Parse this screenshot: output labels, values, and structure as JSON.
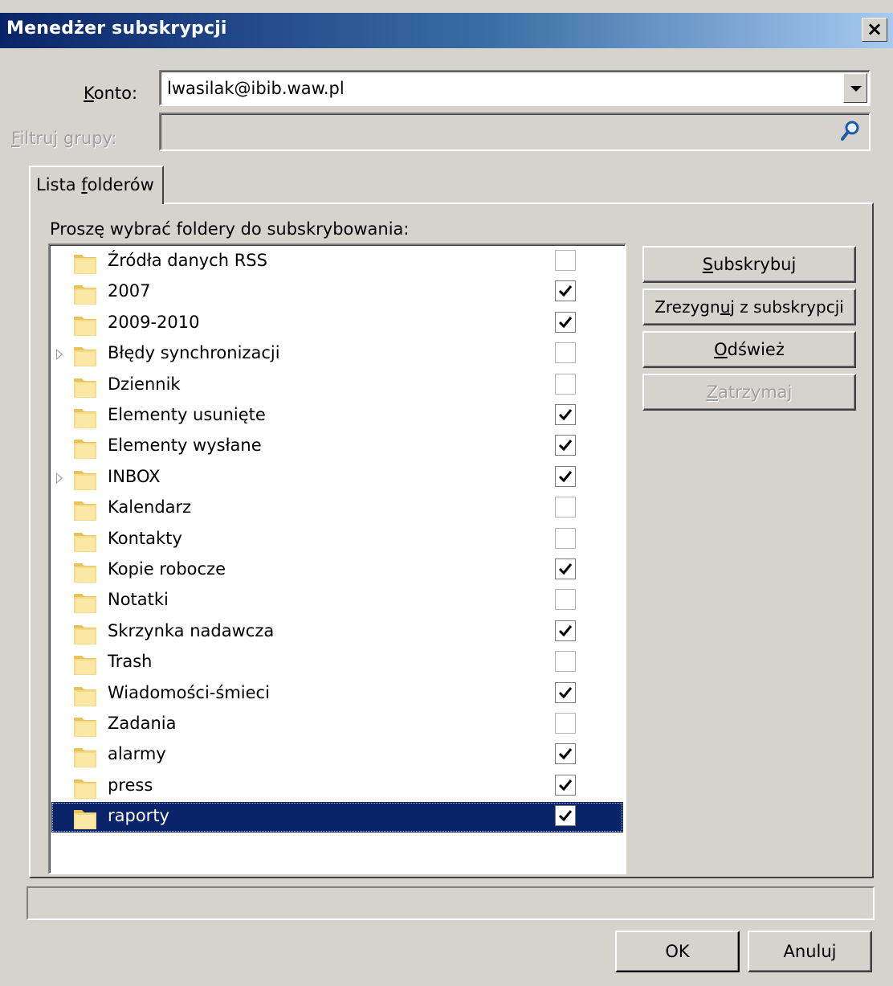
{
  "window": {
    "title": "Menedżer subskrypcji",
    "close_glyph": "×"
  },
  "account": {
    "label": "Konto:",
    "value": "lwasilak@ibib.waw.pl"
  },
  "filter": {
    "label": "Filtruj grupy:",
    "value": "",
    "icon": "search-icon"
  },
  "tab": {
    "label": "Lista folderów"
  },
  "instruction": "Proszę wybrać foldery do subskrybowania:",
  "folders": [
    {
      "name": "Źródła danych RSS",
      "checked": false,
      "expandable": false
    },
    {
      "name": "2007",
      "checked": true,
      "expandable": false
    },
    {
      "name": "2009-2010",
      "checked": true,
      "expandable": false
    },
    {
      "name": "Błędy synchronizacji",
      "checked": false,
      "expandable": true
    },
    {
      "name": "Dziennik",
      "checked": false,
      "expandable": false
    },
    {
      "name": "Elementy usunięte",
      "checked": true,
      "expandable": false
    },
    {
      "name": "Elementy wysłane",
      "checked": true,
      "expandable": false
    },
    {
      "name": "INBOX",
      "checked": true,
      "expandable": true
    },
    {
      "name": "Kalendarz",
      "checked": false,
      "expandable": false
    },
    {
      "name": "Kontakty",
      "checked": false,
      "expandable": false
    },
    {
      "name": "Kopie robocze",
      "checked": true,
      "expandable": false
    },
    {
      "name": "Notatki",
      "checked": false,
      "expandable": false
    },
    {
      "name": "Skrzynka nadawcza",
      "checked": true,
      "expandable": false
    },
    {
      "name": "Trash",
      "checked": false,
      "expandable": false
    },
    {
      "name": "Wiadomości-śmieci",
      "checked": true,
      "expandable": false
    },
    {
      "name": "Zadania",
      "checked": false,
      "expandable": false
    },
    {
      "name": "alarmy",
      "checked": true,
      "expandable": false
    },
    {
      "name": "press",
      "checked": true,
      "expandable": false
    },
    {
      "name": "raporty",
      "checked": true,
      "expandable": false,
      "selected": true
    }
  ],
  "buttons": {
    "subscribe": "Subskrybuj",
    "unsubscribe": "Zrezygnuj z subskrypcji",
    "refresh": "Odśwież",
    "stop": "Zatrzymaj",
    "ok": "OK",
    "cancel": "Anuluj"
  },
  "status_text": "",
  "colors": {
    "dialog_bg": "#d6d3ce",
    "title_start": "#0a246a",
    "title_end": "#a6caf0",
    "selection": "#0a246a",
    "folder_yellow": "#f3d57a"
  }
}
